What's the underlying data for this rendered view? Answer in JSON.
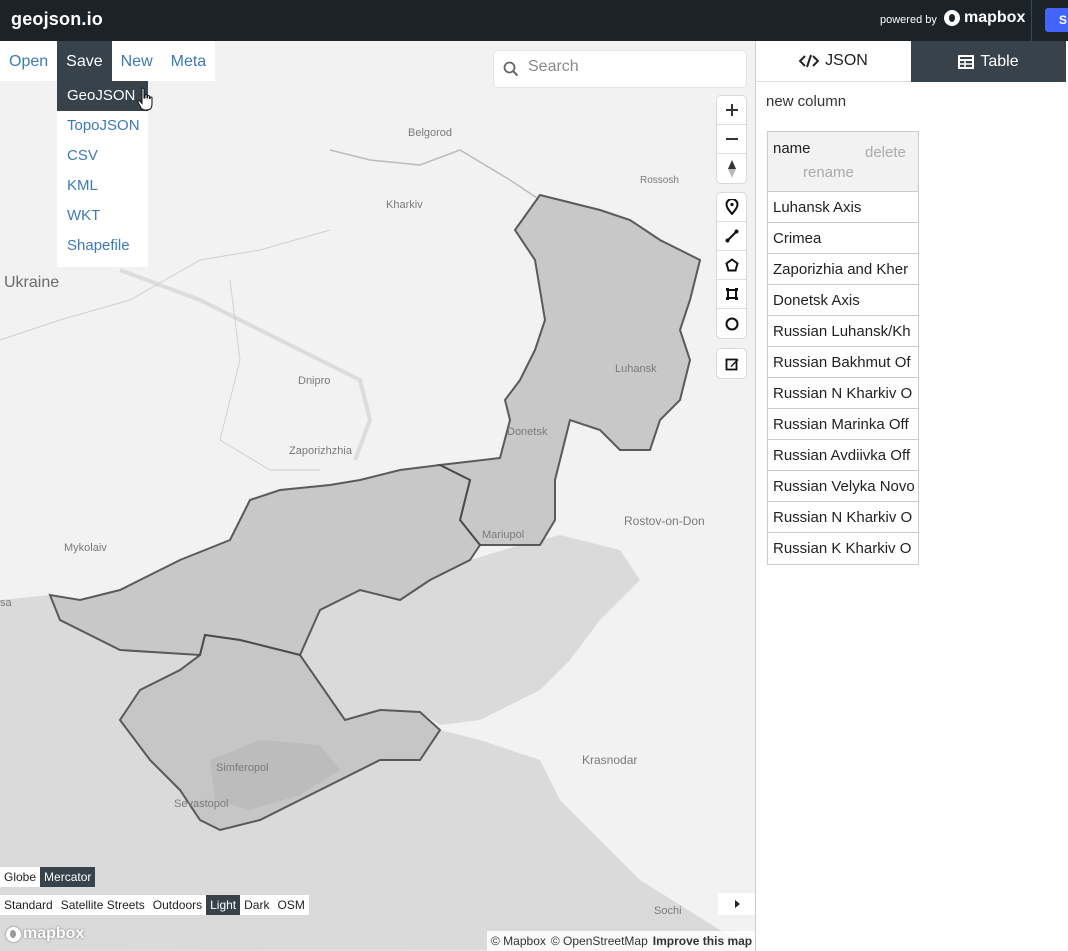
{
  "app": {
    "title": "geojson.io",
    "powered_by": "powered by",
    "brand": "mapbox",
    "signin_label": "S"
  },
  "menu": {
    "items": [
      "Open",
      "Save",
      "New",
      "Meta"
    ],
    "active": "Save"
  },
  "save_dropdown": {
    "items": [
      "GeoJSON",
      "TopoJSON",
      "CSV",
      "KML",
      "WKT",
      "Shapefile"
    ],
    "active": "GeoJSON"
  },
  "search": {
    "placeholder": "Search"
  },
  "map": {
    "labels": {
      "ukraine": "Ukraine",
      "belgorod": "Belgorod",
      "rossosh": "Rossosh",
      "kharkiv": "Kharkiv",
      "luhansk": "Luhansk",
      "dnipro": "Dnipro",
      "donetsk": "Donetsk",
      "zaporizhzhia": "Zaporizhzhia",
      "mariupol": "Mariupol",
      "rostov": "Rostov-on-Don",
      "mykolaiv": "Mykolaiv",
      "odesa": "sa",
      "simferopol": "Simferopol",
      "sevastopol": "Sevastopol",
      "krasnodar": "Krasnodar",
      "sochi": "Sochi"
    },
    "projections": [
      "Globe",
      "Mercator"
    ],
    "active_projection": "Mercator",
    "styles": [
      "Standard",
      "Satellite Streets",
      "Outdoors",
      "Light",
      "Dark",
      "OSM"
    ],
    "active_style": "Light",
    "logo": "mapbox",
    "attribution": {
      "mapbox": "© Mapbox",
      "osm": "© OpenStreetMap",
      "improve": "Improve this map"
    },
    "colors": {
      "land": "#f2f2f2",
      "water": "#d9d9d9",
      "polygon_fill": "#c4c4c4",
      "polygon_stroke": "#4a4a4a"
    }
  },
  "panel": {
    "tabs": [
      "JSON",
      "Table"
    ],
    "active_tab": "Table",
    "new_column": "new column",
    "table": {
      "column": "name",
      "delete_label": "delete",
      "rename_label": "rename",
      "rows": [
        "Luhansk Axis",
        "Crimea",
        "Zaporizhia and Kher",
        "Donetsk Axis",
        "Russian Luhansk/Kh",
        "Russian Bakhmut Of",
        "Russian N Kharkiv O",
        "Russian Marinka Off",
        "Russian Avdiivka Off",
        "Russian Velyka Novo",
        "Russian N Kharkiv O",
        "Russian K Kharkiv O"
      ]
    }
  }
}
